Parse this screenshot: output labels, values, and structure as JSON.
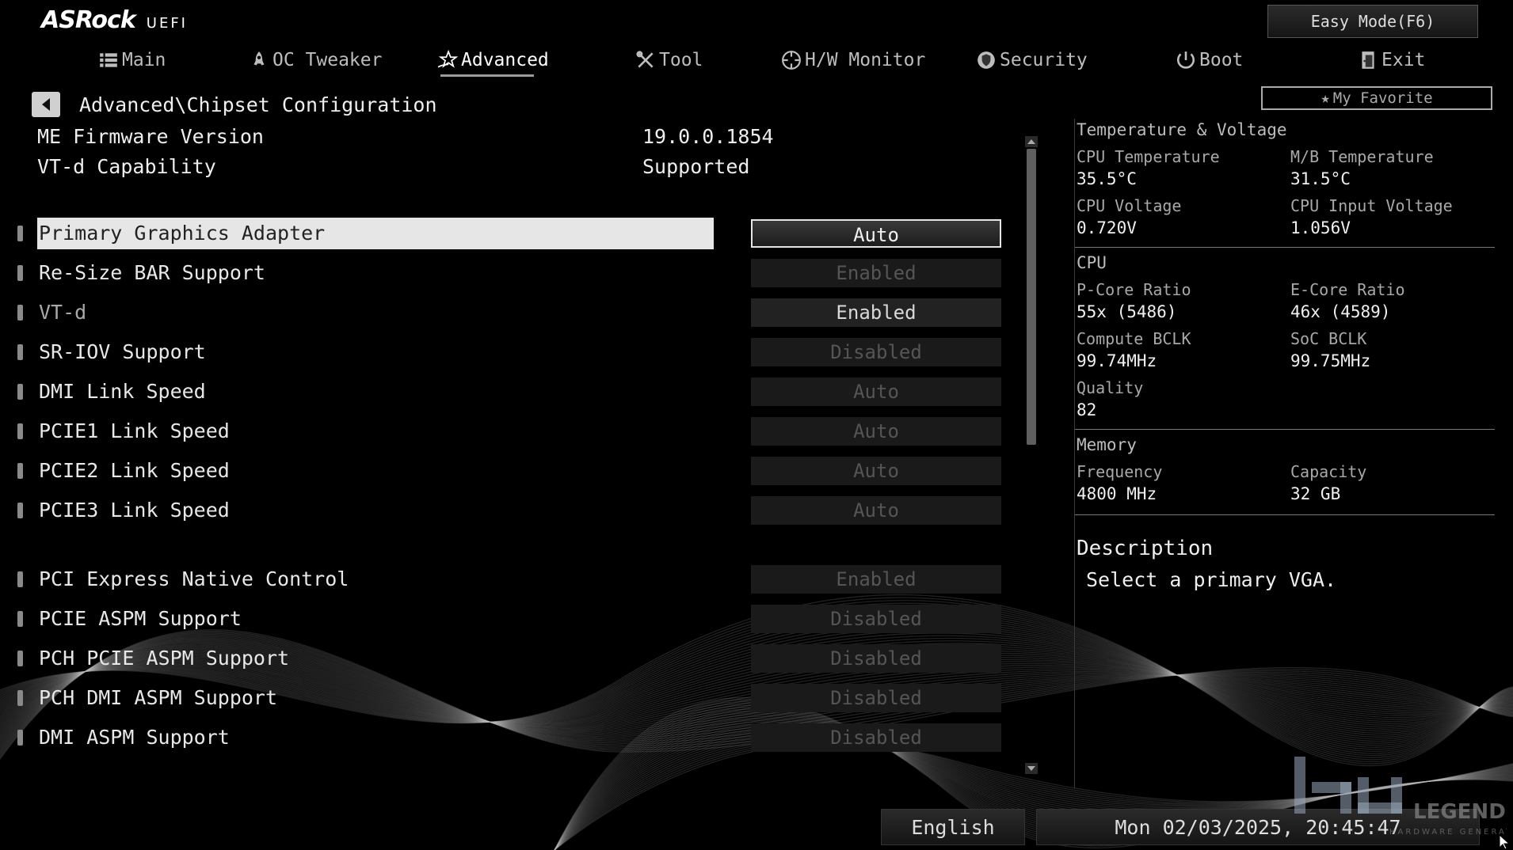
{
  "brand": {
    "name": "ASRock",
    "sub": "UEFI"
  },
  "easy_mode": "Easy Mode(F6)",
  "nav": [
    {
      "label": "Main",
      "icon": "list-icon"
    },
    {
      "label": "OC Tweaker",
      "icon": "rocket-icon"
    },
    {
      "label": "Advanced",
      "icon": "star-icon",
      "active": true
    },
    {
      "label": "Tool",
      "icon": "tools-icon"
    },
    {
      "label": "H/W Monitor",
      "icon": "monitor-icon"
    },
    {
      "label": "Security",
      "icon": "shield-icon"
    },
    {
      "label": "Boot",
      "icon": "power-icon"
    },
    {
      "label": "Exit",
      "icon": "exit-icon"
    }
  ],
  "my_favorite": "My Favorite",
  "breadcrumb": "Advanced\\Chipset Configuration",
  "info": [
    {
      "label": "ME Firmware Version",
      "value": "19.0.0.1854"
    },
    {
      "label": "VT-d Capability",
      "value": "Supported"
    }
  ],
  "settings": [
    {
      "label": "Primary Graphics Adapter",
      "value": "Auto"
    },
    {
      "label": "Re-Size BAR Support",
      "value": "Enabled"
    },
    {
      "label": "VT-d",
      "value": "Enabled"
    },
    {
      "label": "SR-IOV Support",
      "value": "Disabled"
    },
    {
      "label": "DMI Link Speed",
      "value": "Auto"
    },
    {
      "label": "PCIE1 Link Speed",
      "value": "Auto"
    },
    {
      "label": "PCIE2 Link Speed",
      "value": "Auto"
    },
    {
      "label": "PCIE3 Link Speed",
      "value": "Auto"
    },
    {
      "label": "PCI Express Native Control",
      "value": "Enabled"
    },
    {
      "label": "PCIE ASPM Support",
      "value": "Disabled"
    },
    {
      "label": "PCH PCIE ASPM Support",
      "value": "Disabled"
    },
    {
      "label": "PCH DMI ASPM Support",
      "value": "Disabled"
    },
    {
      "label": "DMI ASPM Support",
      "value": "Disabled"
    }
  ],
  "monitor": {
    "temp_title": "Temperature & Voltage",
    "cpu_temp_label": "CPU Temperature",
    "cpu_temp": "35.5°C",
    "mb_temp_label": "M/B Temperature",
    "mb_temp": "31.5°C",
    "cpu_volt_label": "CPU Voltage",
    "cpu_volt": "0.720V",
    "cpu_in_volt_label": "CPU Input Voltage",
    "cpu_in_volt": "1.056V",
    "cpu_title": "CPU",
    "pcore_label": "P-Core Ratio",
    "pcore": "55x (5486)",
    "ecore_label": "E-Core Ratio",
    "ecore": "46x (4589)",
    "bclk_label": "Compute BCLK",
    "bclk": "99.74MHz",
    "soc_label": "SoC BCLK",
    "soc": "99.75MHz",
    "quality_label": "Quality",
    "quality": "82",
    "mem_title": "Memory",
    "freq_label": "Frequency",
    "freq": "4800 MHz",
    "cap_label": "Capacity",
    "cap": "32 GB"
  },
  "description": {
    "title": "Description",
    "text": "Select a primary VGA."
  },
  "footer": {
    "language": "English",
    "datetime": "Mon 02/03/2025, 20:45:47"
  },
  "watermark": {
    "text": "LEGEND",
    "sub": "HARDWARE GENERATION"
  }
}
